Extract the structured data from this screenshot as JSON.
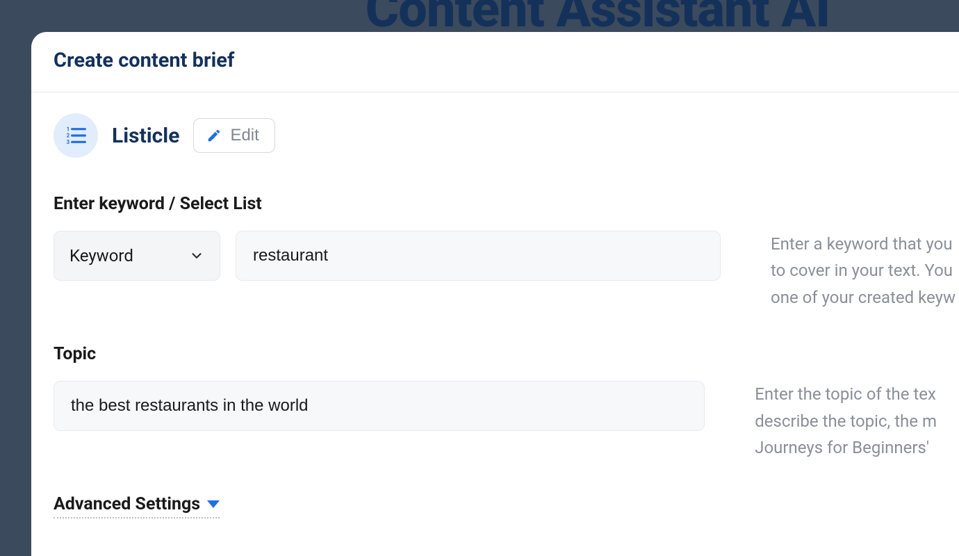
{
  "background": {
    "title": "Content Assistant AI"
  },
  "panel": {
    "title": "Create content brief"
  },
  "content_type": {
    "icon": "list-icon",
    "name": "Listicle",
    "edit_label": "Edit"
  },
  "keyword_section": {
    "label": "Enter keyword / Select List",
    "select_value": "Keyword",
    "input_value": "restaurant",
    "help_line1": "Enter a keyword that you",
    "help_line2": "to cover in your text. You",
    "help_line3": "one of your created keyw"
  },
  "topic_section": {
    "label": "Topic",
    "input_value": "the best restaurants in the world",
    "help_line1": "Enter the topic of the tex",
    "help_line2": "describe the topic, the m",
    "help_line3": "Journeys for Beginners'"
  },
  "advanced": {
    "label": "Advanced Settings"
  }
}
